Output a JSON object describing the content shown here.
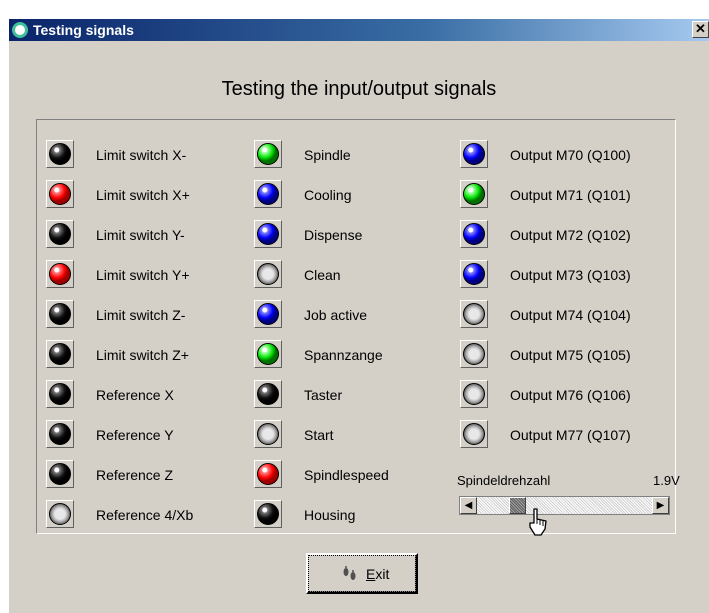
{
  "window": {
    "title": "Testing signals",
    "close_glyph": "✕"
  },
  "heading": "Testing the input/output signals",
  "signals": {
    "inputs": [
      {
        "label": "Limit switch X-",
        "state": "black"
      },
      {
        "label": "Limit switch X+",
        "state": "red"
      },
      {
        "label": "Limit switch Y-",
        "state": "black"
      },
      {
        "label": "Limit switch Y+",
        "state": "red"
      },
      {
        "label": "Limit switch Z-",
        "state": "black"
      },
      {
        "label": "Limit switch Z+",
        "state": "black"
      },
      {
        "label": "Reference X",
        "state": "black"
      },
      {
        "label": "Reference Y",
        "state": "black"
      },
      {
        "label": "Reference Z",
        "state": "black"
      },
      {
        "label": "Reference 4/Xb",
        "state": "gray"
      }
    ],
    "machine": [
      {
        "label": "Spindle",
        "state": "green"
      },
      {
        "label": "Cooling",
        "state": "blue"
      },
      {
        "label": "Dispense",
        "state": "blue"
      },
      {
        "label": "Clean",
        "state": "gray"
      },
      {
        "label": "Job active",
        "state": "blue"
      },
      {
        "label": "Spannzange",
        "state": "green"
      },
      {
        "label": "Taster",
        "state": "black"
      },
      {
        "label": "Start",
        "state": "gray"
      },
      {
        "label": "Spindlespeed",
        "state": "red"
      },
      {
        "label": "Housing",
        "state": "black"
      }
    ],
    "outputs": [
      {
        "label": "Output M70 (Q100)",
        "state": "blue"
      },
      {
        "label": "Output M71 (Q101)",
        "state": "green"
      },
      {
        "label": "Output M72 (Q102)",
        "state": "blue"
      },
      {
        "label": "Output M73 (Q103)",
        "state": "blue"
      },
      {
        "label": "Output M74 (Q104)",
        "state": "gray"
      },
      {
        "label": "Output M75 (Q105)",
        "state": "gray"
      },
      {
        "label": "Output M76 (Q106)",
        "state": "gray"
      },
      {
        "label": "Output M77 (Q107)",
        "state": "gray"
      }
    ]
  },
  "spindle_slider": {
    "label": "Spindeldrehzahl",
    "value": "1.9V",
    "position_fraction": 0.2,
    "left_arrow": "◀",
    "right_arrow": "▶"
  },
  "exit_button": {
    "mnemonic": "E",
    "rest": "xit",
    "icon": "exit-footprints-icon"
  },
  "colors": {
    "title_bar": "#0a246a",
    "face": "#d4d0c8",
    "led_black": "#000000",
    "led_red": "#ff0000",
    "led_green": "#00e000",
    "led_blue": "#0000ff",
    "led_gray": "#c0c0c0"
  }
}
